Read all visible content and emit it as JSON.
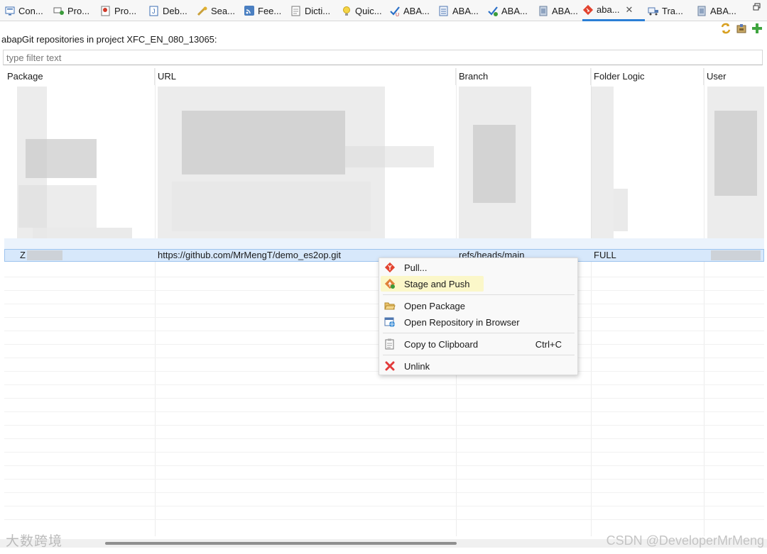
{
  "tabs": [
    {
      "label": "Con...",
      "icon": "console-icon"
    },
    {
      "label": "Pro...",
      "icon": "properties-icon"
    },
    {
      "label": "Pro...",
      "icon": "problems-icon"
    },
    {
      "label": "Deb...",
      "icon": "debug-icon"
    },
    {
      "label": "Sea...",
      "icon": "search-icon"
    },
    {
      "label": "Fee...",
      "icon": "feed-icon"
    },
    {
      "label": "Dicti...",
      "icon": "dictionary-icon"
    },
    {
      "label": "Quic...",
      "icon": "lightbulb-icon"
    },
    {
      "label": "ABA...",
      "icon": "abap-unit-icon"
    },
    {
      "label": "ABA...",
      "icon": "abap-doc-icon"
    },
    {
      "label": "ABA...",
      "icon": "abap-coverage-icon"
    },
    {
      "label": "ABA...",
      "icon": "abap-object-icon"
    },
    {
      "label": "aba...",
      "icon": "abapgit-icon"
    },
    {
      "label": "Tra...",
      "icon": "transport-icon"
    },
    {
      "label": "ABA...",
      "icon": "abap-object-icon"
    }
  ],
  "title": "abapGit repositories in project XFC_EN_080_13065:",
  "filter": {
    "placeholder": "type filter text",
    "value": ""
  },
  "table": {
    "columns": [
      "Package",
      "URL",
      "Branch",
      "Folder Logic",
      "User"
    ],
    "selected_row": {
      "package": "Z",
      "url": "https://github.com/MrMengT/demo_es2op.git",
      "branch": "refs/heads/main",
      "folder_logic": "FULL",
      "user": ""
    }
  },
  "context_menu": {
    "pull": "Pull...",
    "stage_push": "Stage and Push",
    "open_package": "Open Package",
    "open_repo": "Open Repository in Browser",
    "copy": "Copy to Clipboard",
    "copy_shortcut": "Ctrl+C",
    "unlink": "Unlink"
  },
  "watermarks": {
    "left": "大数跨境",
    "right": "CSDN @DeveloperMrMeng"
  }
}
